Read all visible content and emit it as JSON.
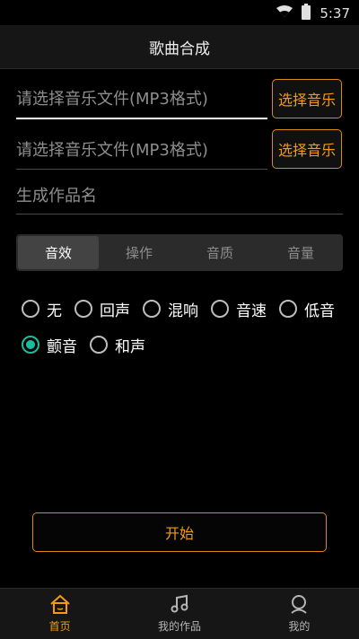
{
  "status_bar": {
    "time": "5:37",
    "icons": [
      "wifi-icon",
      "battery-icon"
    ]
  },
  "header": {
    "title": "歌曲合成"
  },
  "inputs": [
    {
      "placeholder": "请选择音乐文件(MP3格式)",
      "button_label": "选择音乐"
    },
    {
      "placeholder": "请选择音乐文件(MP3格式)",
      "button_label": "选择音乐"
    }
  ],
  "name_input": {
    "placeholder": "生成作品名"
  },
  "tabs": [
    {
      "label": "音效",
      "selected": true
    },
    {
      "label": "操作",
      "selected": false
    },
    {
      "label": "音质",
      "selected": false
    },
    {
      "label": "音量",
      "selected": false
    }
  ],
  "effects": {
    "row1": [
      "无",
      "回声",
      "混响",
      "音速",
      "低音"
    ],
    "row2": [
      "颤音",
      "和声"
    ],
    "selected": "颤音"
  },
  "start_button": {
    "label": "开始"
  },
  "bottom_nav": [
    {
      "label": "首页",
      "icon": "home-icon",
      "active": true
    },
    {
      "label": "我的作品",
      "icon": "music-note-icon",
      "active": false
    },
    {
      "label": "我的",
      "icon": "user-icon",
      "active": false
    }
  ],
  "colors": {
    "accent": "#f39c12",
    "radio_checked": "#1abc9c",
    "background": "#000000"
  }
}
